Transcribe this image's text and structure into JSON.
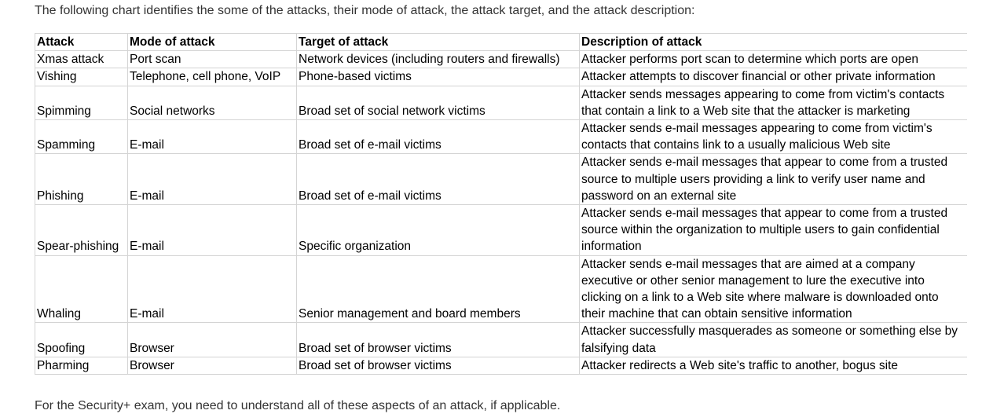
{
  "intro_text": "The following chart identifies the some of the attacks, their mode of attack, the attack target, and the attack description:",
  "outro_text": "For the Security+ exam, you need to understand all of these aspects of an attack, if applicable.",
  "table": {
    "headers": [
      "Attack",
      "Mode of attack",
      "Target of attack",
      "Description of attack"
    ],
    "rows": [
      [
        "Xmas attack",
        "Port scan",
        "Network devices (including routers and firewalls)",
        "Attacker performs port scan to determine which ports are open"
      ],
      [
        "Vishing",
        "Telephone, cell phone, VoIP",
        "Phone-based victims",
        "Attacker attempts to discover financial or other private information"
      ],
      [
        "Spimming",
        "Social networks",
        "Broad set of social network victims",
        "Attacker sends messages appearing to come from victim's contacts that contain a link to a Web site that the attacker is marketing"
      ],
      [
        "Spamming",
        "E-mail",
        "Broad set of e-mail victims",
        "Attacker sends e-mail messages appearing to come from victim's contacts that contains link to a usually malicious Web site"
      ],
      [
        "Phishing",
        "E-mail",
        "Broad set of e-mail victims",
        "Attacker sends e-mail messages that appear to come from a trusted source to multiple users providing a link to verify user name and password on an external site"
      ],
      [
        "Spear-phishing",
        "E-mail",
        "Specific organization",
        "Attacker sends e-mail messages that appear to come from a trusted source within the organization to multiple users to gain confidential information"
      ],
      [
        "Whaling",
        "E-mail",
        "Senior management and board members",
        "Attacker sends e-mail messages that are aimed at a company executive or other senior management to lure the executive into clicking on a link to a Web site where malware is downloaded onto their machine that can obtain sensitive information"
      ],
      [
        "Spoofing",
        "Browser",
        "Broad set of browser victims",
        "Attacker successfully masquerades as someone or something else by falsifying data"
      ],
      [
        "Pharming",
        "Browser",
        "Broad set of browser victims",
        "Attacker redirects a Web site's traffic to another, bogus site"
      ]
    ]
  }
}
